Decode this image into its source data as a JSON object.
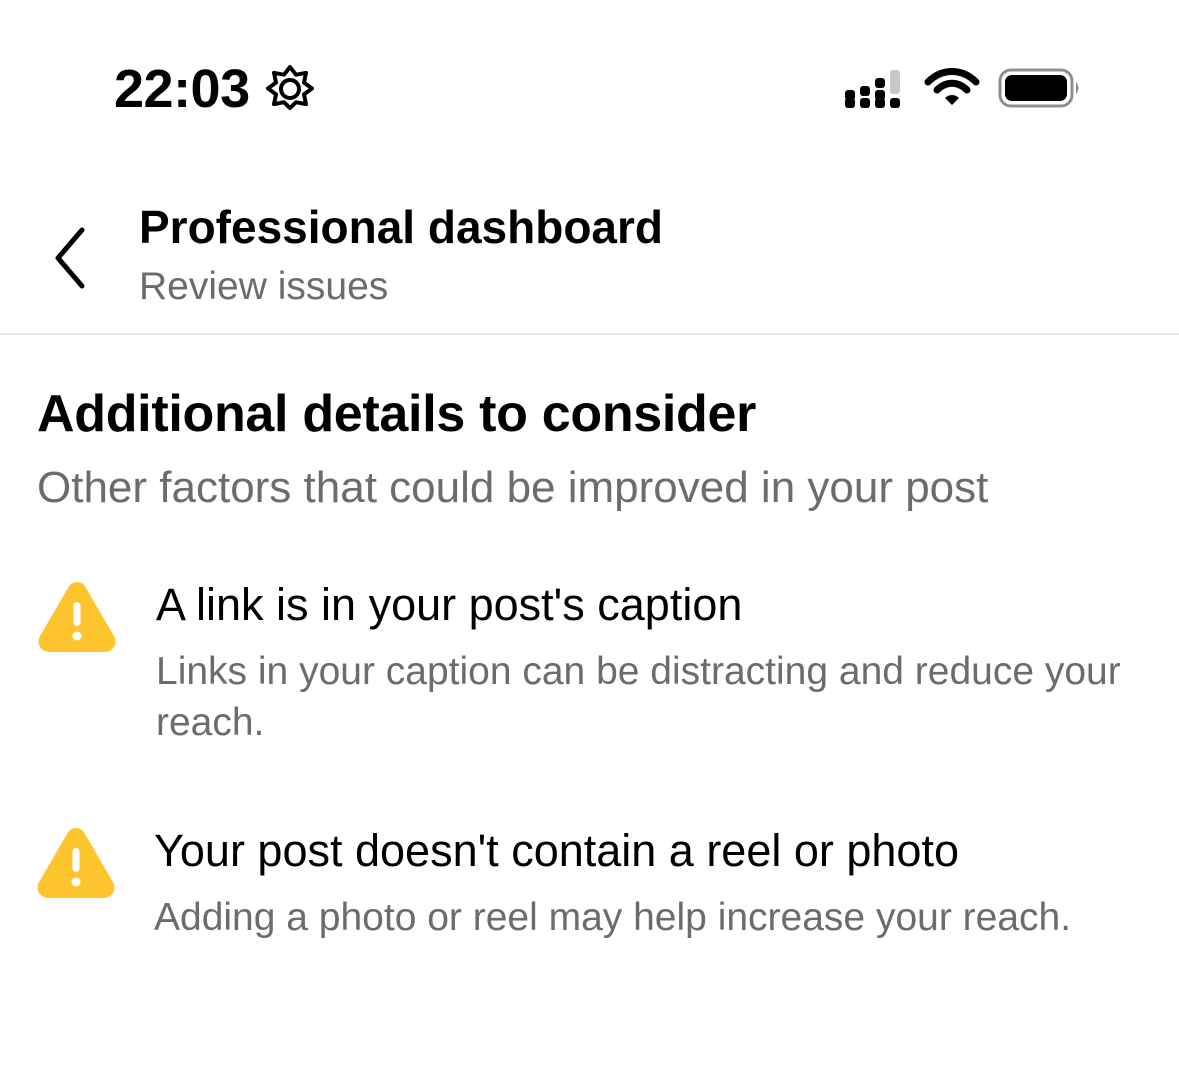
{
  "status_bar": {
    "time": "22:03",
    "icons": [
      "focus-mode-icon",
      "cellular-signal-icon",
      "wifi-icon",
      "battery-icon"
    ]
  },
  "header": {
    "back_icon": "chevron-left-icon",
    "title": "Professional dashboard",
    "subtitle": "Review issues"
  },
  "section": {
    "title": "Additional details to consider",
    "subtitle": "Other factors that could be improved in your post"
  },
  "issues": [
    {
      "icon": "warning-icon",
      "title": "A link is in your post's caption",
      "description": "Links in your caption can be distracting and reduce your reach."
    },
    {
      "icon": "warning-icon",
      "title": "Your post doesn't contain a reel or photo",
      "description": "Adding a photo or reel may help increase your reach."
    }
  ],
  "colors": {
    "warning": "#FDC42E",
    "secondary_text": "#6B6B70",
    "divider": "#E6E6E6"
  }
}
